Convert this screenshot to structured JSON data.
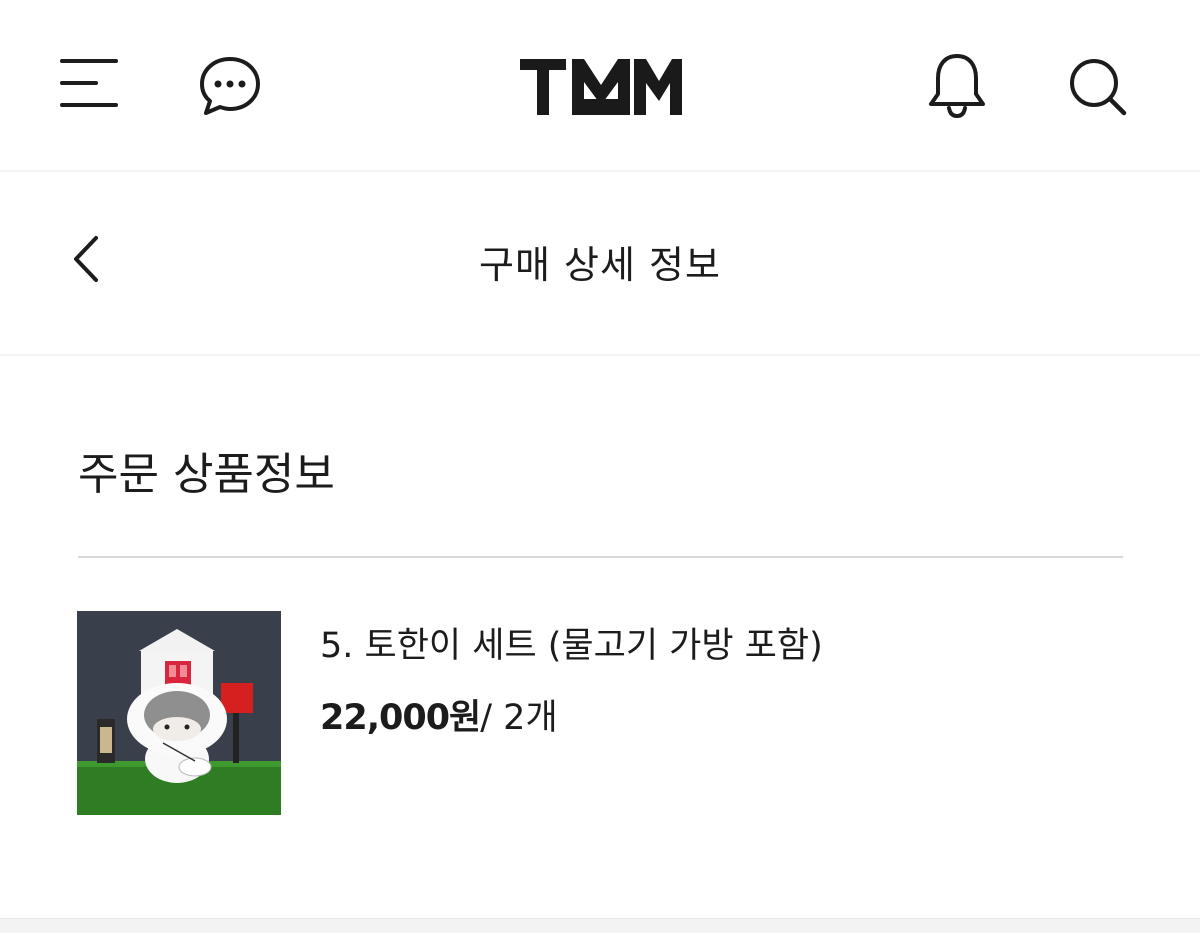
{
  "header": {
    "logo_text": "TMM",
    "icons": {
      "menu": "menu-icon",
      "chat": "chat-bubble-icon",
      "notifications": "bell-icon",
      "search": "search-icon"
    }
  },
  "subheader": {
    "title": "구매 상세 정보",
    "back_icon": "chevron-left-icon"
  },
  "order": {
    "section_title": "주문 상품정보",
    "items": [
      {
        "name": "5. 토한이 세트 (물고기 가방 포함)",
        "price": "22,000원",
        "quantity": "/ 2개"
      }
    ]
  },
  "colors": {
    "text": "#1c1c1c",
    "divider": "#d8d8d8",
    "background": "#ffffff"
  }
}
